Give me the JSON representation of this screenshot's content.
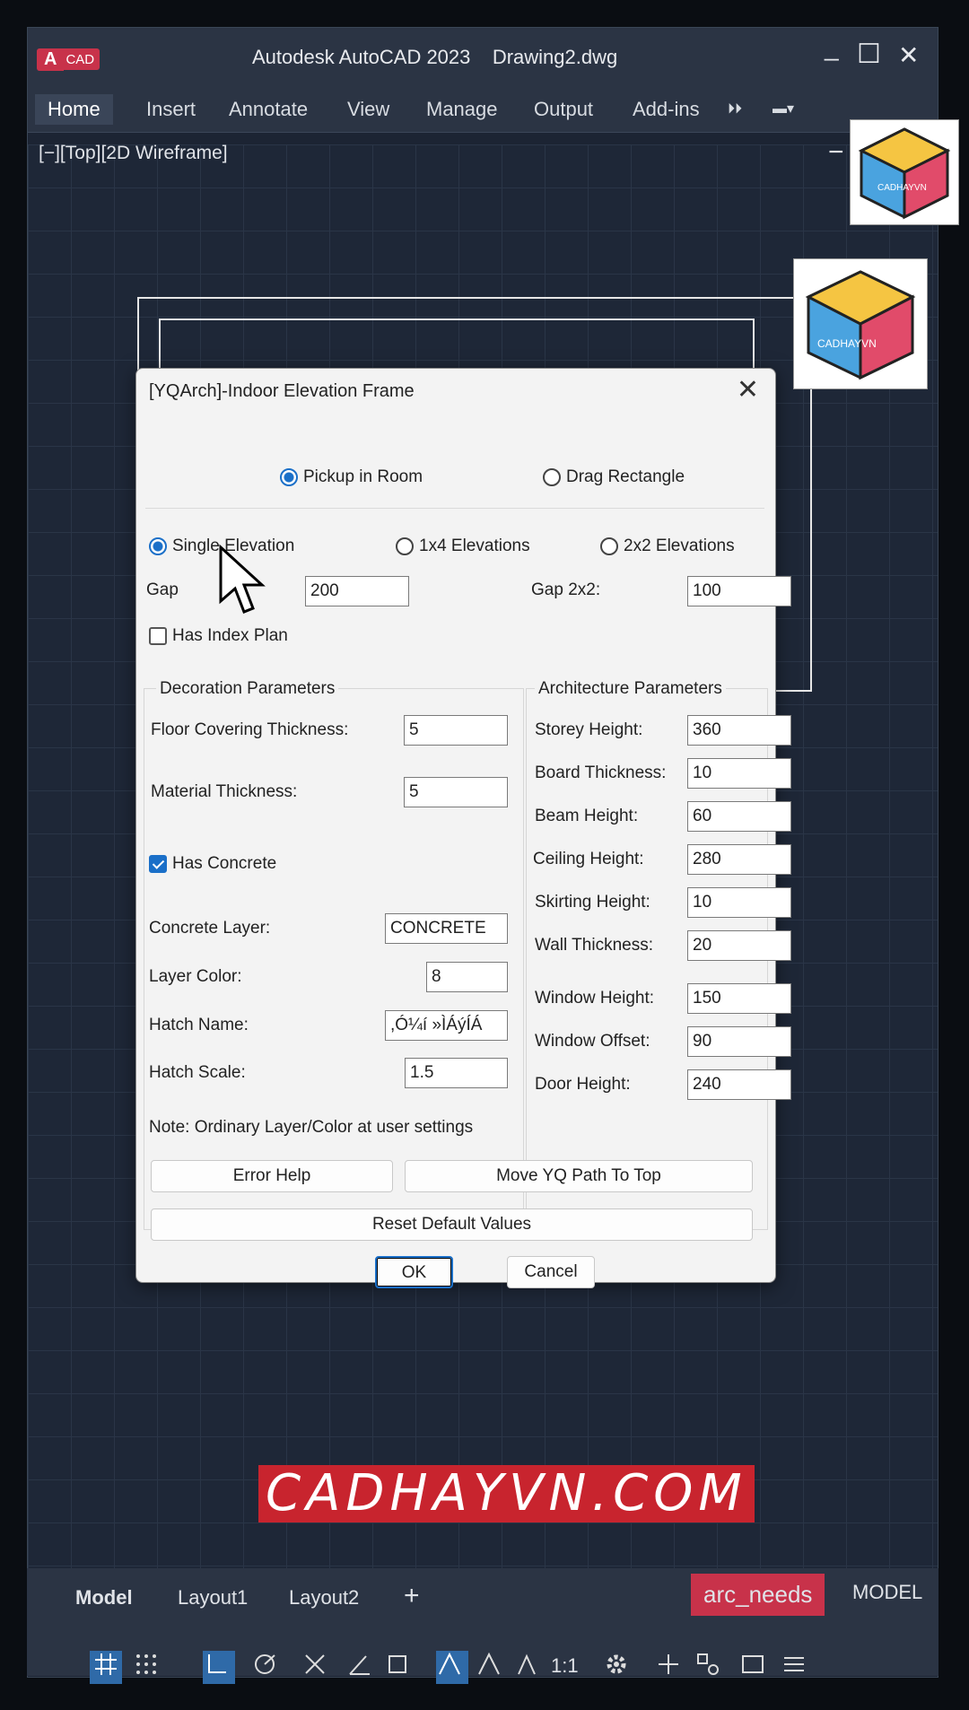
{
  "app": {
    "logo_a": "A",
    "logo_cad": "CAD",
    "title": "Autodesk AutoCAD 2023    Drawing2.dwg",
    "minimize": "_",
    "maximize": "☐",
    "close": "✕"
  },
  "ribbon": {
    "tabs": [
      "Home",
      "Insert",
      "Annotate",
      "View",
      "Manage",
      "Output",
      "Add-ins"
    ],
    "overflow": "⏵⏵",
    "workspace": "▬▾"
  },
  "viewport": {
    "label": "[−][Top][2D Wireframe]",
    "collapse": "−"
  },
  "dialog": {
    "title": "[YQArch]-Indoor Elevation Frame",
    "close": "✕",
    "mode": {
      "pickup": "Pickup in Room",
      "drag": "Drag Rectangle",
      "selected": "pickup"
    },
    "elevation": {
      "single": "Single Elevation",
      "x4": "1x4 Elevations",
      "x2": "2x2 Elevations",
      "selected": "single"
    },
    "gap_label": "Gap",
    "gap_value": "200",
    "gap2x2_label": "Gap 2x2:",
    "gap2x2_value": "100",
    "has_index_plan": "Has Index Plan",
    "decoration": {
      "title": "Decoration Parameters",
      "floor_label": "Floor Covering Thickness:",
      "floor_value": "5",
      "material_label": "Material Thickness:",
      "material_value": "5",
      "has_concrete": "Has Concrete",
      "concrete_layer_label": "Concrete Layer:",
      "concrete_layer_value": "CONCRETE",
      "layer_color_label": "Layer Color:",
      "layer_color_value": "8",
      "hatch_name_label": "Hatch Name:",
      "hatch_name_value": ",Ó¼í »ÌÁýÍÁ",
      "hatch_scale_label": "Hatch Scale:",
      "hatch_scale_value": "1.5"
    },
    "architecture": {
      "title": "Architecture Parameters",
      "rows": [
        {
          "label": "Storey Height:",
          "value": "360"
        },
        {
          "label": "Board Thickness:",
          "value": "10"
        },
        {
          "label": "Beam Height:",
          "value": "60"
        },
        {
          "label": "Ceiling Height:",
          "value": "280"
        },
        {
          "label": "Skirting Height:",
          "value": "10"
        },
        {
          "label": "Wall Thickness:",
          "value": "20"
        },
        {
          "label": "Window Height:",
          "value": "150"
        },
        {
          "label": "Window Offset:",
          "value": "90"
        },
        {
          "label": "Door Height:",
          "value": "240"
        }
      ]
    },
    "note": "Note: Ordinary Layer/Color at user settings",
    "error_help": "Error Help",
    "move_path": "Move YQ Path To Top",
    "reset": "Reset Default Values",
    "ok": "OK",
    "cancel": "Cancel"
  },
  "watermark": "CADHAYVN.COM",
  "thumb_text": "CADHAYVN",
  "status": {
    "layout_tabs": [
      "Model",
      "Layout1",
      "Layout2"
    ],
    "add": "+",
    "badge": "arc_needs",
    "model": "MODEL",
    "scale": "1:1"
  },
  "colors": {
    "accent": "#1a6fc8",
    "brand": "#c8242e",
    "bg": "#1c2433"
  }
}
